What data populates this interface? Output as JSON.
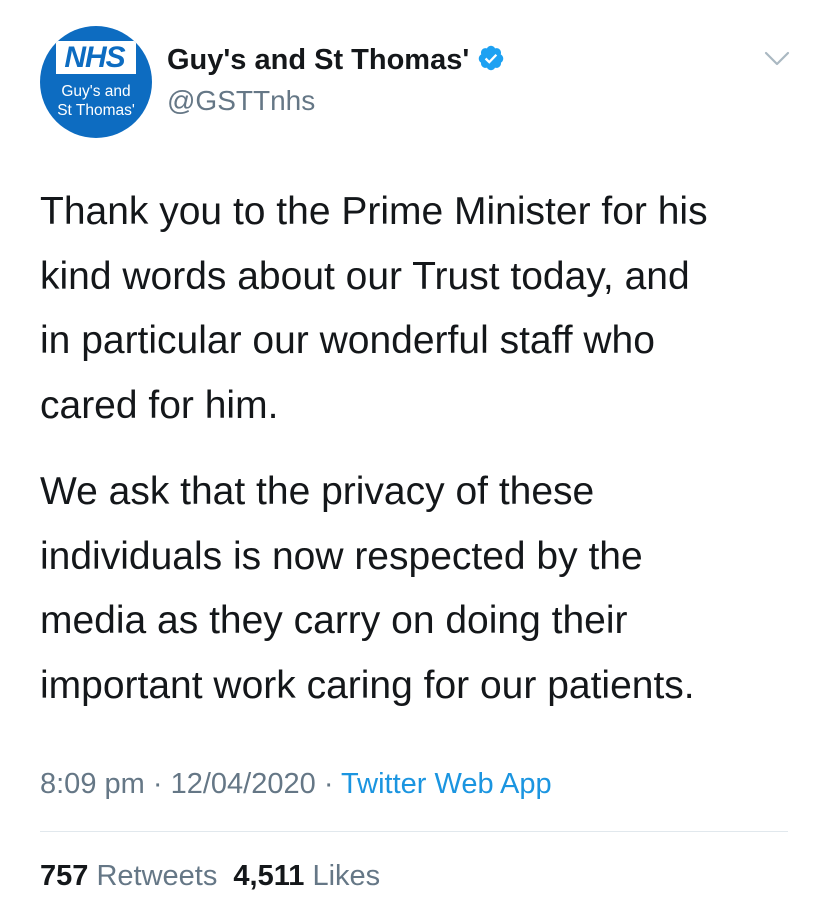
{
  "account": {
    "avatar": {
      "logo_text": "NHS",
      "org_line1": "Guy's and",
      "org_line2": "St Thomas'"
    },
    "display_name": "Guy's and St Thomas'",
    "handle": "@GSTTnhs",
    "verified": true
  },
  "tweet": {
    "paragraph1_lines": [
      "Thank you to the Prime Minister for his",
      "kind words about our Trust today, and",
      "in particular our wonderful staff who",
      "cared for him."
    ],
    "paragraph2_lines": [
      "We ask that the privacy of these",
      "individuals is now respected by the",
      "media as they carry on doing their",
      "important work caring for our patients."
    ]
  },
  "meta": {
    "time": "8:09 pm",
    "separator": "·",
    "date": "12/04/2020",
    "source": "Twitter Web App"
  },
  "stats": {
    "retweets_count": "757",
    "retweets_label": "Retweets",
    "likes_count": "4,511",
    "likes_label": "Likes"
  },
  "colors": {
    "text_primary": "#14171a",
    "text_secondary": "#657786",
    "link_blue": "#1b95e0",
    "nhs_blue": "#0d6cc1",
    "verified_blue": "#1da1f2",
    "divider": "#e1e8ed"
  },
  "icons": {
    "verified": "verified-badge-icon",
    "menu": "chevron-down-icon"
  }
}
